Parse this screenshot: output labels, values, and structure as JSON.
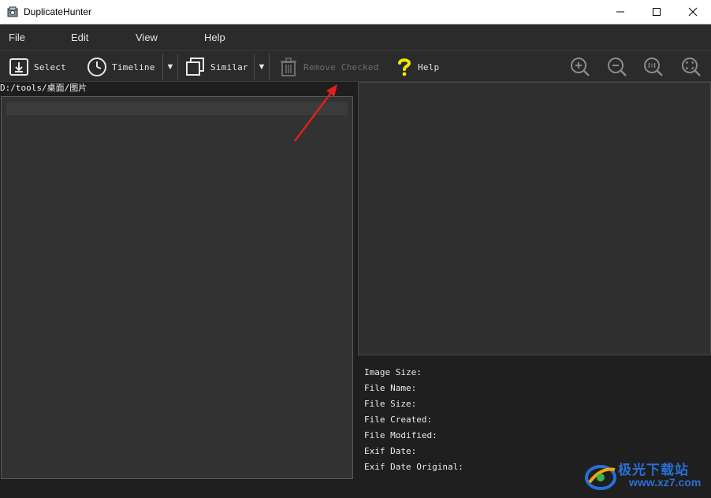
{
  "window": {
    "title": "DuplicateHunter",
    "controls": [
      "minimize-icon",
      "maximize-icon",
      "close-icon"
    ]
  },
  "menu": {
    "items": [
      "File",
      "Edit",
      "View",
      "Help"
    ]
  },
  "toolbar": {
    "select_label": "Select",
    "timeline_label": "Timeline",
    "similar_label": "Similar",
    "remove_checked_label": "Remove Checked",
    "help_label": "Help",
    "dropdown_glyph": "▼",
    "zoom_in_icon": "zoom-in-icon",
    "zoom_out_icon": "zoom-out-icon",
    "zoom_actual_icon": "zoom-actual-size-icon",
    "zoom_fit_icon": "zoom-fit-icon"
  },
  "path": {
    "current": "D:/tools/桌面/图片"
  },
  "details": {
    "image_size": "Image Size:",
    "file_name": "File Name:",
    "file_size": "File Size:",
    "file_created": "File Created:",
    "file_modified": "File Modified:",
    "exif_date": "Exif Date:",
    "exif_date_original": "Exif Date Original:"
  },
  "watermark": {
    "brand": "极光下载站",
    "url": "www.xz7.com"
  },
  "colors": {
    "accent_help": "#f2e600",
    "annotation_arrow": "#e0201c",
    "watermark_blue": "#2a6fd6"
  }
}
